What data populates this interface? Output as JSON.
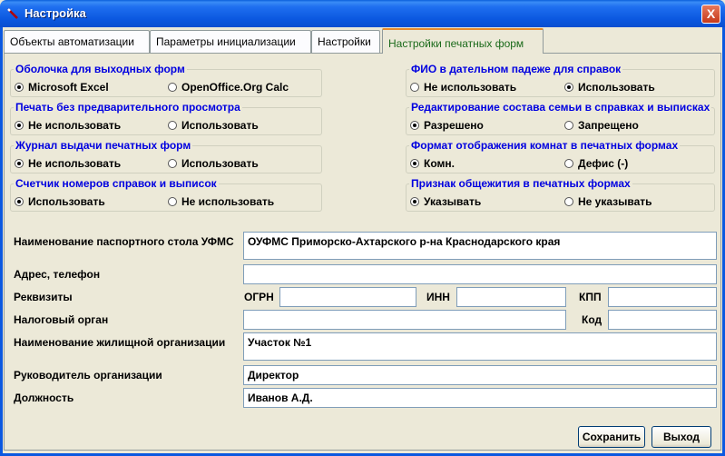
{
  "window": {
    "title": "Настройка",
    "close_glyph": "X"
  },
  "tabs": [
    {
      "label": "Объекты автоматизации"
    },
    {
      "label": "Параметры инициализации"
    },
    {
      "label": "Настройки"
    },
    {
      "label": "Настройки печатных форм"
    }
  ],
  "groups": {
    "shell": {
      "title": "Оболочка для выходных форм",
      "options": [
        "Microsoft Excel",
        "OpenOffice.Org Calc"
      ],
      "selected": 0
    },
    "preview": {
      "title": "Печать без предварительного просмотра",
      "options": [
        "Не использовать",
        "Использовать"
      ],
      "selected": 0
    },
    "journal": {
      "title": "Журнал выдачи печатных форм",
      "options": [
        "Не использовать",
        "Использовать"
      ],
      "selected": 0
    },
    "counter": {
      "title": "Счетчик номеров справок и выписок",
      "options": [
        "Использовать",
        "Не использовать"
      ],
      "selected": 0
    },
    "fio": {
      "title": "ФИО в дательном падеже для справок",
      "options": [
        "Не использовать",
        "Использовать"
      ],
      "selected": 1
    },
    "family": {
      "title": "Редактирование состава семьи в справках и выписках",
      "options": [
        "Разрешено",
        "Запрещено"
      ],
      "selected": 0
    },
    "rooms": {
      "title": "Формат отображения комнат в печатных формах",
      "options": [
        "Комн.",
        "Дефис (-)"
      ],
      "selected": 0
    },
    "dorm": {
      "title": "Признак общежития в печатных формах",
      "options": [
        "Указывать",
        "Не указывать"
      ],
      "selected": 0
    }
  },
  "form": {
    "passport_office_label": "Наименование паспортного стола УФМС",
    "passport_office_value": "ОУФМС Приморско-Ахтарского р-на Краснодарского края",
    "address_label": "Адрес, телефон",
    "address_value": "",
    "requisites_label": "Реквизиты",
    "ogrn_label": "ОГРН",
    "ogrn_value": "",
    "inn_label": "ИНН",
    "inn_value": "",
    "kpp_label": "КПП",
    "kpp_value": "",
    "tax_label": "Налоговый орган",
    "tax_value": "",
    "code_label": "Код",
    "code_value": "",
    "housing_org_label": "Наименование жилищной организации",
    "housing_org_value": "Участок №1",
    "head_label": "Руководитель организации",
    "head_value": "Директор",
    "position_label": "Должность",
    "position_value": "Иванов А.Д."
  },
  "buttons": {
    "save": "Сохранить",
    "exit": "Выход"
  }
}
